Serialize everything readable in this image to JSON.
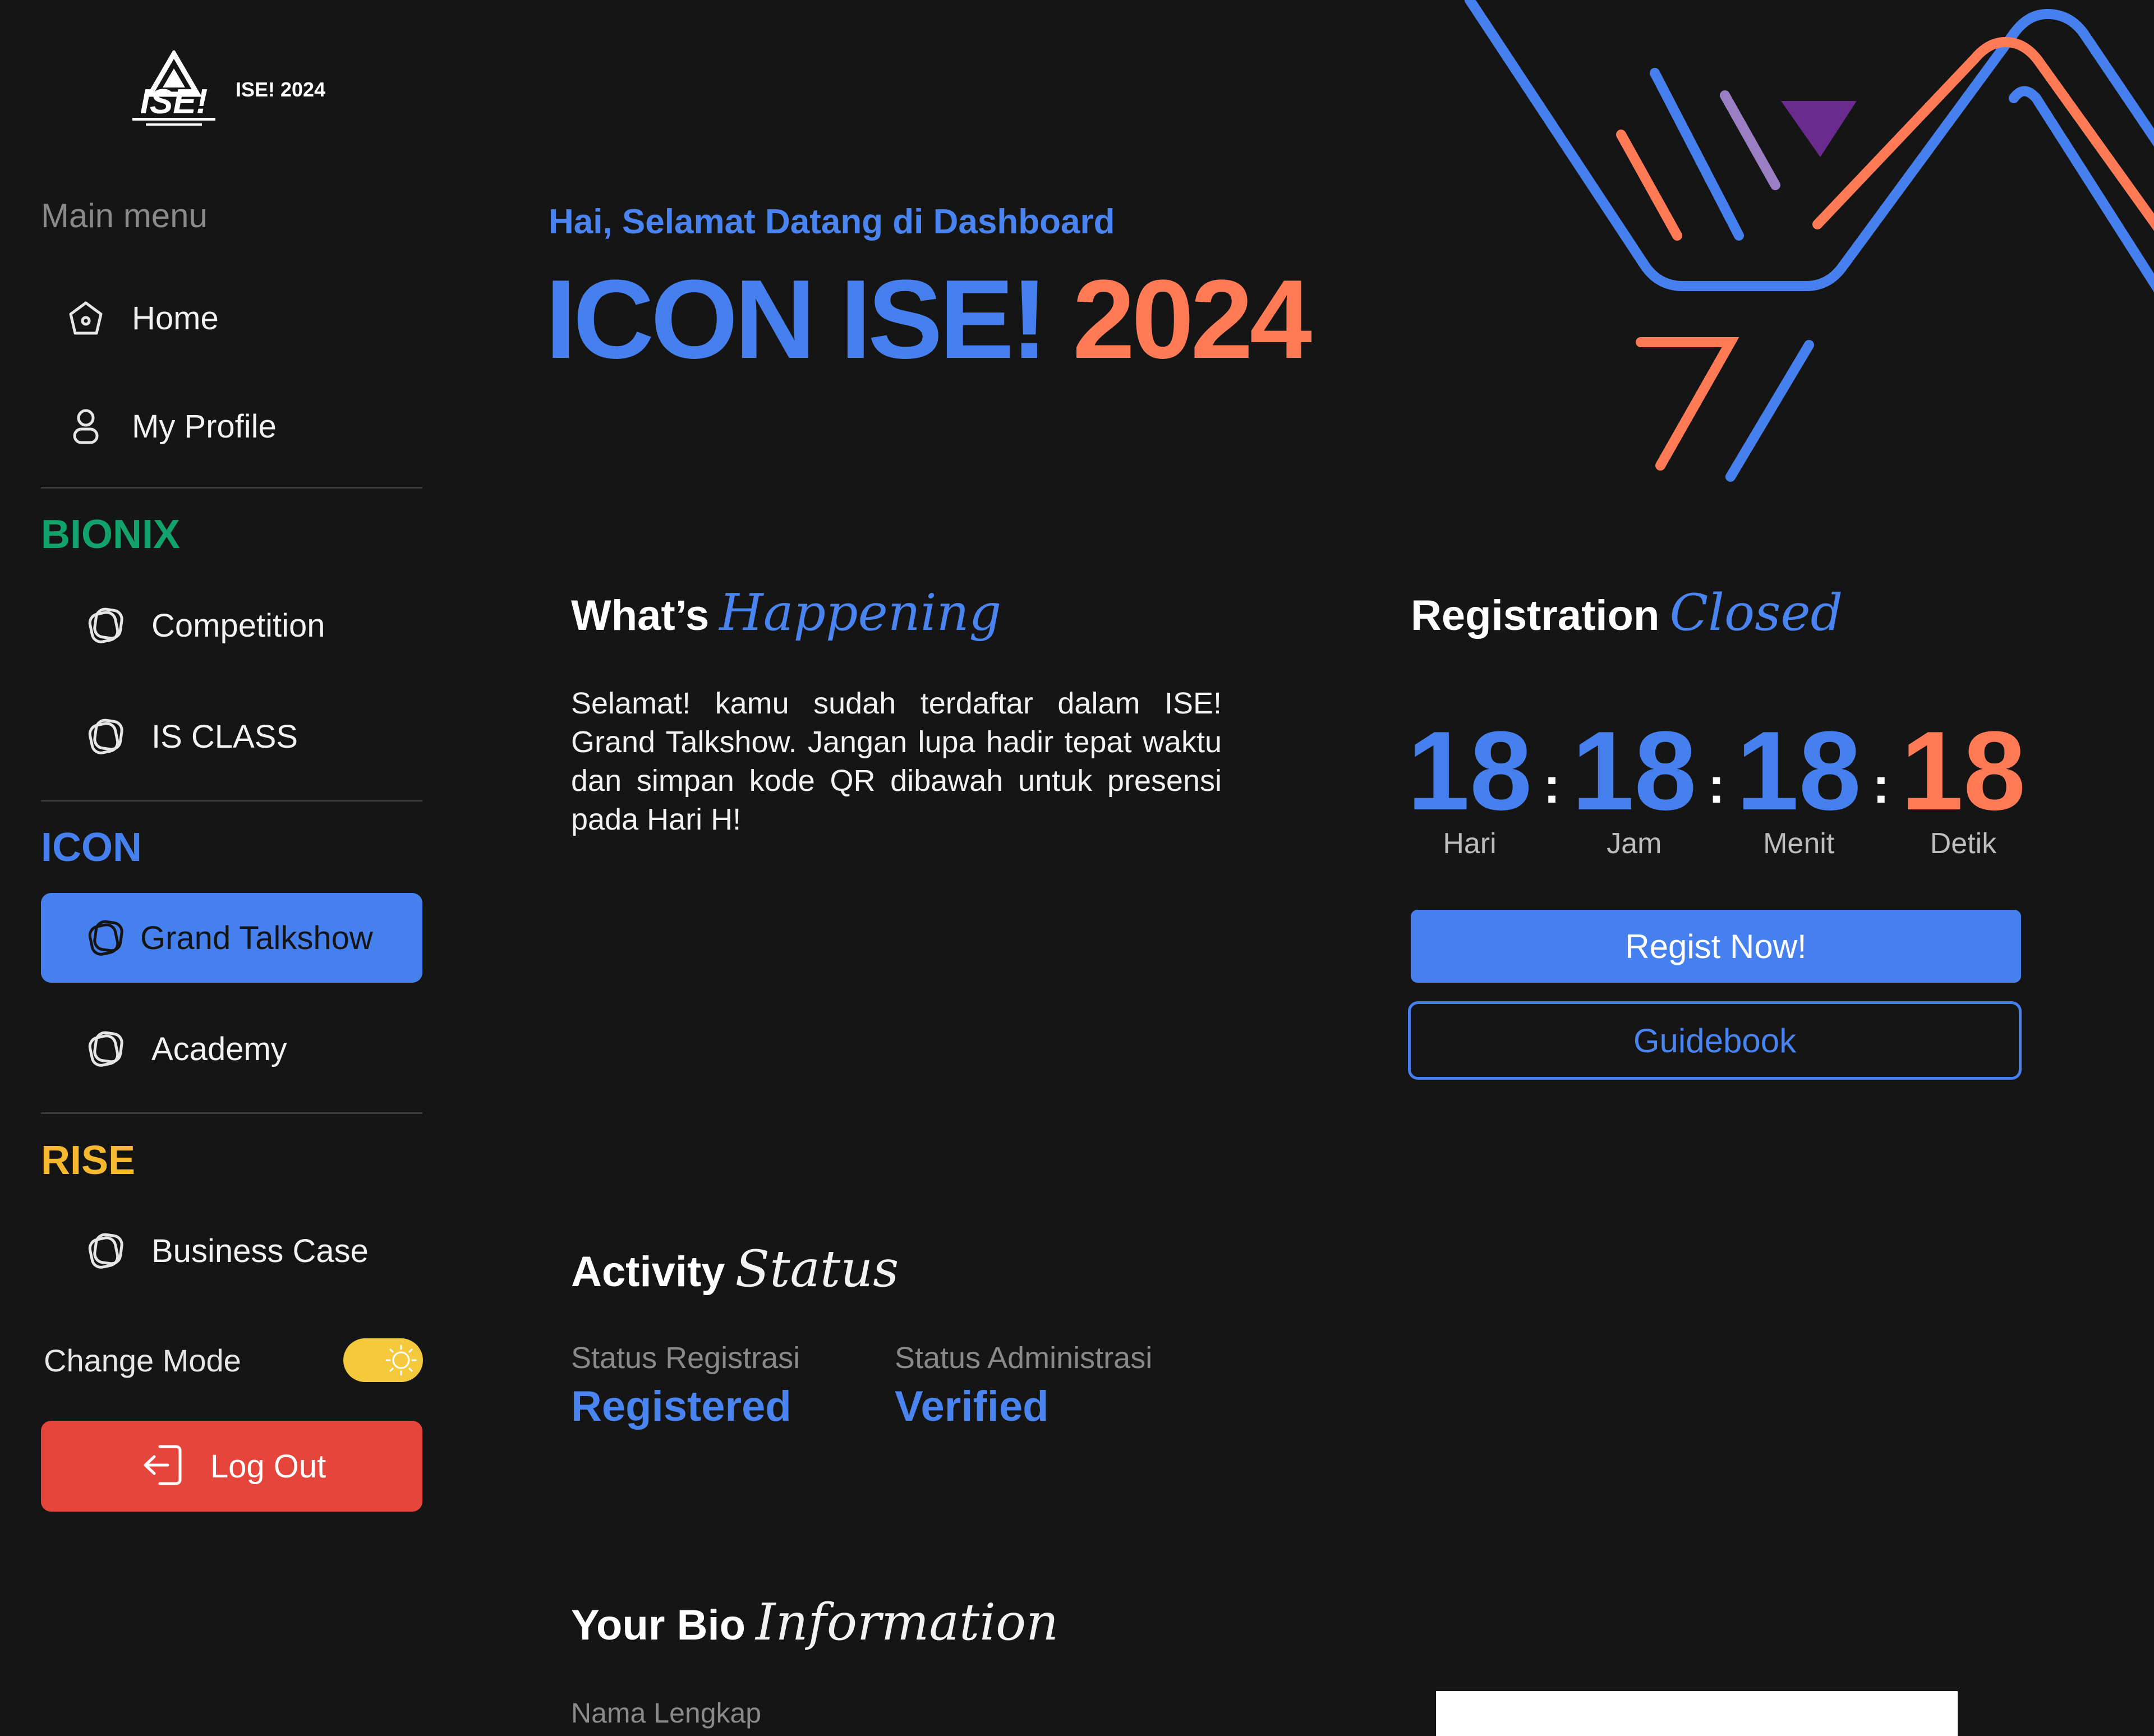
{
  "app": {
    "logo_text": "ISE! 2024"
  },
  "sidebar": {
    "main_menu_label": "Main menu",
    "main_items": [
      {
        "label": "Home",
        "icon": "home-icon"
      },
      {
        "label": "My Profile",
        "icon": "user-icon"
      }
    ],
    "groups": [
      {
        "title": "BIONIX",
        "color": "#11a36b",
        "items": [
          {
            "label": "Competition"
          },
          {
            "label": "IS CLASS"
          }
        ]
      },
      {
        "title": "ICON",
        "color": "#4680ee",
        "items": [
          {
            "label": "Grand Talkshow",
            "active": true
          },
          {
            "label": "Academy"
          }
        ]
      },
      {
        "title": "RISE",
        "color": "#f5b82e",
        "items": [
          {
            "label": "Business Case"
          }
        ]
      }
    ],
    "change_mode_label": "Change Mode",
    "logout_label": "Log Out"
  },
  "header": {
    "greeting": "Hai, Selamat Datang di Dashboard",
    "title_part1": "ICON ISE!",
    "title_part2": "2024"
  },
  "happening": {
    "title_plain": "What’s",
    "title_script": "Happening",
    "text": "Selamat! kamu sudah terdaftar dalam ISE! Grand Talkshow. Jangan lupa hadir tepat waktu dan simpan kode QR dibawah untuk presensi pada Hari H!"
  },
  "registration": {
    "title_plain": "Registration",
    "title_script": "Closed",
    "countdown": [
      {
        "value": "18",
        "label": "Hari",
        "color": "#4680ee"
      },
      {
        "value": "18",
        "label": "Jam",
        "color": "#4680ee"
      },
      {
        "value": "18",
        "label": "Menit",
        "color": "#4680ee"
      },
      {
        "value": "18",
        "label": "Detik",
        "color": "#ff7a55"
      }
    ],
    "separator": ":",
    "regist_button": "Regist Now!",
    "guidebook_button": "Guidebook"
  },
  "activity": {
    "title_plain": "Activity",
    "title_script": "Status",
    "status_registrasi_label": "Status Registrasi",
    "status_registrasi_value": "Registered",
    "status_administrasi_label": "Status Administrasi",
    "status_administrasi_value": "Verified"
  },
  "bio": {
    "title_plain": "Your Bio",
    "title_script": "Information",
    "field_label": "Nama Lengkap"
  },
  "colors": {
    "accent": "#4680ee",
    "orange": "#ff7a55",
    "danger": "#e5453a",
    "toggle": "#f5c93c",
    "background": "#151515"
  }
}
